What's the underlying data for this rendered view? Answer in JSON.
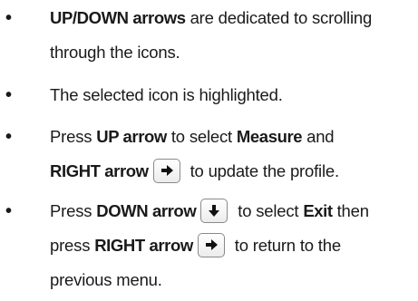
{
  "bullets": [
    {
      "line1_bold": "UP/DOWN arrows",
      "line1_rest": " are dedicated to scrolling",
      "line2": "through the icons."
    },
    {
      "line1": "The selected icon is highlighted."
    },
    {
      "line1_a": "Press ",
      "line1_bold_a": "UP arrow",
      "line1_b": " to select ",
      "line1_bold_b": "Measure",
      "line1_c": " and",
      "line2_bold": "RIGHT arrow",
      "line2_rest": " to update the profile.",
      "key_icon": "right-arrow-key-icon"
    },
    {
      "line1_a": "Press ",
      "line1_bold_a": "DOWN arrow",
      "line1_b": " to select ",
      "line1_bold_b": "Exit",
      "line1_c": " then",
      "line2_a": "press ",
      "line2_bold": "RIGHT arrow",
      "line2_rest": " to return to the",
      "line3": "previous menu.",
      "key_icons": [
        "down-arrow-key-icon",
        "right-arrow-key-icon"
      ]
    }
  ],
  "bullet_glyph": "•"
}
